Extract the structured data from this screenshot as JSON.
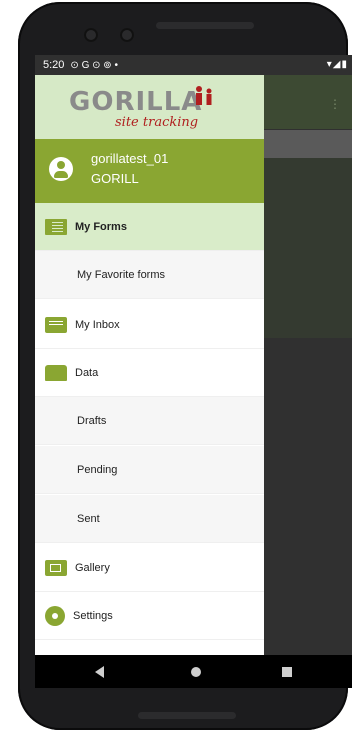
{
  "status_bar": {
    "time": "5:20",
    "icons": "⊙ G ⊙ ⊚ •",
    "right_icons": "▾◢▮"
  },
  "logo": {
    "word": "GORILLA",
    "sub": "site tracking"
  },
  "user": {
    "name": "gorillatest_01",
    "org": "GORILL"
  },
  "menu": [
    {
      "label": "My Forms",
      "icon": "forms-icon",
      "active": true
    },
    {
      "label": "My Favorite forms",
      "sub": true
    },
    {
      "label": "My Inbox",
      "icon": "inbox-icon"
    },
    {
      "label": "Data",
      "icon": "folder-icon"
    },
    {
      "label": "Drafts",
      "sub": true
    },
    {
      "label": "Pending",
      "sub": true
    },
    {
      "label": "Sent",
      "sub": true
    },
    {
      "label": "Gallery",
      "icon": "gallery-icon"
    },
    {
      "label": "Settings",
      "icon": "gear-icon"
    }
  ],
  "colors": {
    "accent": "#8aa632",
    "accent_light": "#d9ecc9",
    "brand_red": "#b01f1f"
  },
  "navigation": {
    "back": "back-icon",
    "home": "home-icon",
    "recents": "recents-icon"
  }
}
